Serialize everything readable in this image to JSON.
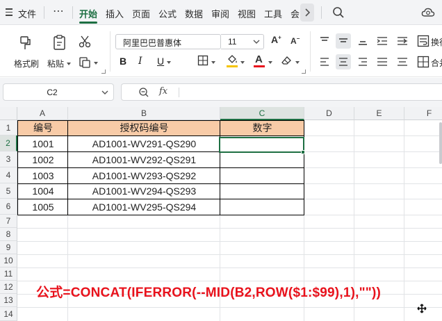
{
  "menu": {
    "file": "文件",
    "more": "⋯",
    "tabs": [
      "开始",
      "插入",
      "页面",
      "公式",
      "数据",
      "审阅",
      "视图",
      "工具",
      "会"
    ]
  },
  "ribbon": {
    "format_painter": "格式刷",
    "paste": "粘贴",
    "font_name": "阿里巴巴普惠体",
    "font_size": "11",
    "bold": "B",
    "italic": "I",
    "underline": "U",
    "font_color_accent": "#e8121c",
    "highlight_color_accent": "#f5c400",
    "wrap_label": "换行",
    "merge_label": "合并"
  },
  "formula_bar": {
    "name_box": "C2",
    "fx": "fx",
    "formula": ""
  },
  "sheet": {
    "columns": [
      "A",
      "B",
      "C",
      "D",
      "E",
      "F"
    ],
    "rows": [
      "1",
      "2",
      "3",
      "4",
      "5",
      "6",
      "7",
      "8",
      "9",
      "10",
      "11",
      "12",
      "13",
      "14"
    ],
    "selected_cell": "C2",
    "header_fill": "#f8cba7",
    "headers": [
      "编号",
      "授权码编号",
      "数字"
    ],
    "data": [
      [
        "1001",
        "AD1001-WV291-QS290",
        ""
      ],
      [
        "1002",
        "AD1001-WV292-QS291",
        ""
      ],
      [
        "1003",
        "AD1001-WV293-QS292",
        ""
      ],
      [
        "1004",
        "AD1001-WV294-QS293",
        ""
      ],
      [
        "1005",
        "AD1001-WV295-QS294",
        ""
      ]
    ],
    "annotation": "公式=CONCAT(IFERROR(--MID(B2,ROW($1:$99),1),\"\"))",
    "annotation_color": "#e8121c"
  }
}
